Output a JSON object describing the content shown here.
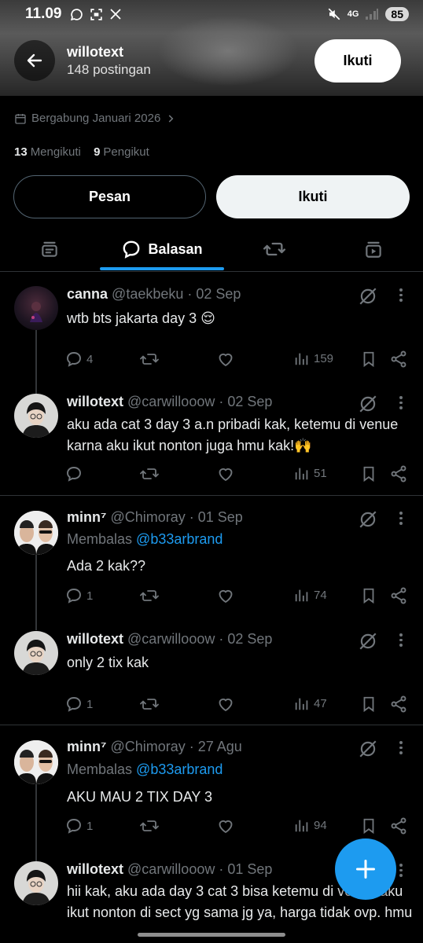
{
  "status_bar": {
    "time": "11.09",
    "network": "4G",
    "battery": "85"
  },
  "header": {
    "username": "willotext",
    "posts": "148 postingan",
    "follow_label": "Ikuti"
  },
  "profile": {
    "joined": "Bergabung Januari 2026",
    "following_count": "13",
    "following_label": "Mengikuti",
    "followers_count": "9",
    "followers_label": "Pengikut",
    "message_label": "Pesan",
    "follow_label": "Ikuti"
  },
  "tabs": {
    "active_label": "Balasan"
  },
  "tweets": [
    {
      "name": "canna",
      "handle": "@taekbeku · 02 Sep",
      "text": "wtb bts jakarta day 3 😌",
      "replies": "4",
      "views": "159"
    },
    {
      "name": "willotext",
      "handle": "@carwillooow · 02 Sep",
      "text": "aku ada cat 3 day 3 a.n pribadi kak, ketemu di venue karna aku ikut nonton juga hmu kak!🙌",
      "replies": "",
      "views": "51"
    },
    {
      "name": "minn⁷",
      "handle": "@Chimoray · 01 Sep",
      "reply_prefix": "Membalas",
      "reply_to": "@b33arbrand",
      "text": "Ada 2 kak??",
      "replies": "1",
      "views": "74"
    },
    {
      "name": "willotext",
      "handle": "@carwillooow · 02 Sep",
      "text": "only 2 tix kak",
      "replies": "1",
      "views": "47"
    },
    {
      "name": "minn⁷",
      "handle": "@Chimoray · 27 Agu",
      "reply_prefix": "Membalas",
      "reply_to": "@b33arbrand",
      "text": "AKU MAU 2 TIX DAY 3",
      "replies": "1",
      "views": "94"
    },
    {
      "name": "willotext",
      "handle": "@carwillooow · 01 Sep",
      "text": "hii kak, aku ada day 3 cat 3 bisa ketemu di venue aku ikut nonton di sect yg sama jg ya, harga tidak ovp. hmu"
    }
  ],
  "colors": {
    "accent": "#1d9bf0",
    "background": "#000000",
    "muted": "#71767b"
  }
}
